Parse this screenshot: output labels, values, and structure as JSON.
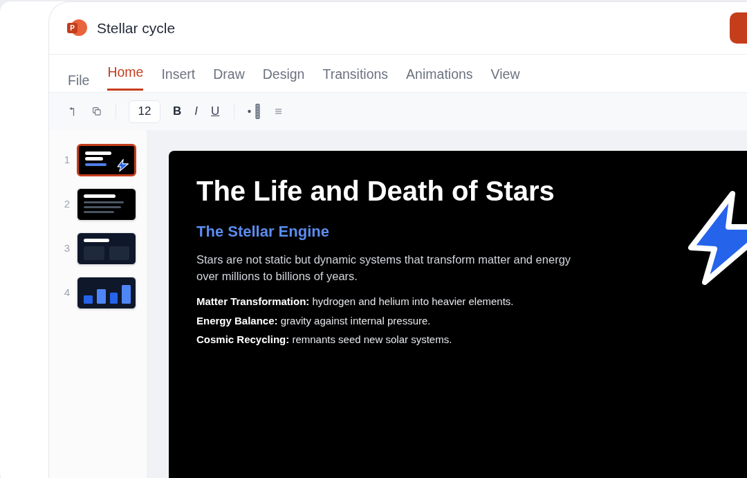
{
  "window": {
    "logo_letter": "P",
    "title": "Stellar cycle"
  },
  "tabs": [
    {
      "label": "File",
      "kind": "menu",
      "selected": false
    },
    {
      "label": "Home",
      "kind": "tab",
      "selected": true
    },
    {
      "label": "Insert",
      "kind": "tab",
      "selected": false
    },
    {
      "label": "Draw",
      "kind": "tab",
      "selected": false
    },
    {
      "label": "Design",
      "kind": "tab",
      "selected": false
    },
    {
      "label": "Transitions",
      "kind": "tab",
      "selected": false
    },
    {
      "label": "Animations",
      "kind": "tab",
      "selected": false
    },
    {
      "label": "View",
      "kind": "tab",
      "selected": false
    }
  ],
  "toolbar": {
    "font_size": "12",
    "bold": "B",
    "italic": "I",
    "underline": "U"
  },
  "slides": [
    {
      "number": "1",
      "kind": "title",
      "selected": true
    },
    {
      "number": "2",
      "kind": "text",
      "selected": false
    },
    {
      "number": "3",
      "kind": "columns",
      "selected": false
    },
    {
      "number": "4",
      "kind": "chart",
      "selected": false
    }
  ],
  "slide": {
    "title": "The Life and Death of Stars",
    "subtitle": "The Stellar Engine",
    "paragraph": "Stars are not static but dynamic systems that transform matter and energy over millions to billions of years.",
    "points": [
      "**Matter Transformation:** hydrogen and helium into heavier elements.",
      "**Energy Balance:** gravity against internal pressure.",
      "**Cosmic Recycling:** remnants seed new solar systems."
    ]
  }
}
